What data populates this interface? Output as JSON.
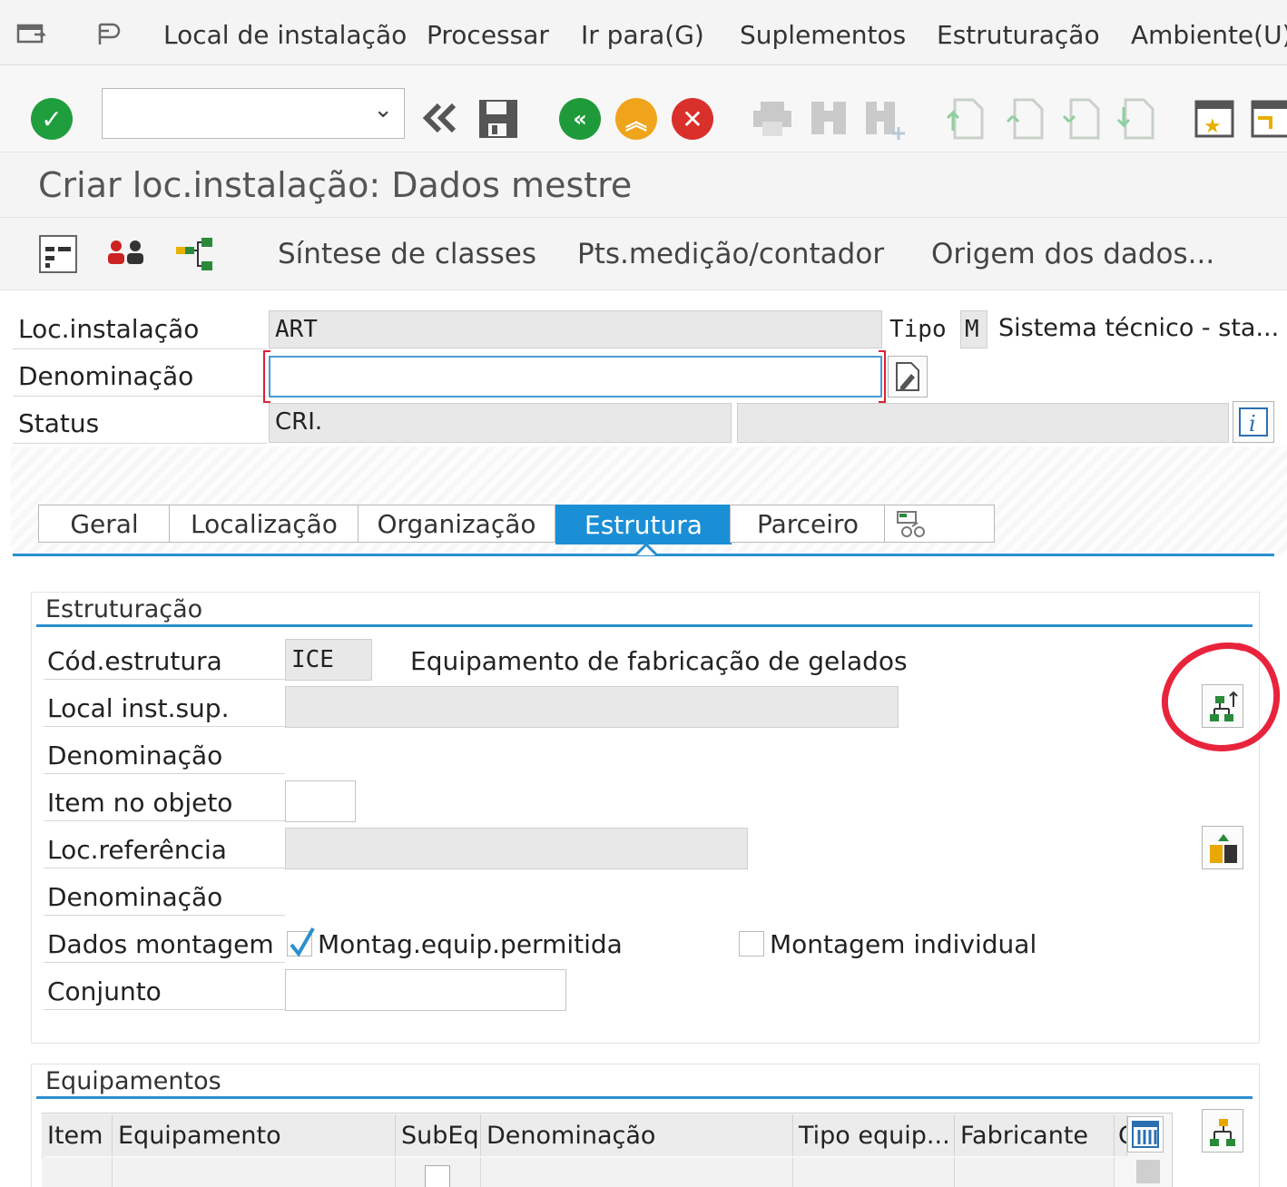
{
  "menu": {
    "items": [
      "Local de instalação",
      "Processar",
      "Ir para(G)",
      "Suplementos",
      "Estruturação",
      "Ambiente(U)"
    ]
  },
  "toolbar": {
    "command_field_value": "",
    "icons": [
      "enter-icon",
      "back-double-icon",
      "save-icon",
      "back-icon",
      "exit-icon",
      "cancel-icon",
      "print-icon",
      "find-icon",
      "find-next-icon",
      "first-page-icon",
      "previous-page-icon",
      "next-page-icon",
      "last-page-icon",
      "create-session-icon",
      "shortcut-icon"
    ]
  },
  "title": "Criar loc.instalação: Dados mestre",
  "app_toolbar": {
    "links": [
      "Síntese de classes",
      "Pts.medição/contador",
      "Origem dos dados..."
    ]
  },
  "header": {
    "loc_instalacao_label": "Loc.instalação",
    "loc_instalacao_value": "ART",
    "tipo_label": "Tipo",
    "tipo_value": "M",
    "tipo_text": "Sistema técnico - sta...",
    "denominacao_label": "Denominação",
    "denominacao_value": "",
    "status_label": "Status",
    "status_value": "CRI.",
    "status_value2": ""
  },
  "tabs": [
    {
      "label": "Geral",
      "active": false
    },
    {
      "label": "Localização",
      "active": false
    },
    {
      "label": "Organização",
      "active": false
    },
    {
      "label": "Estrutura",
      "active": true
    },
    {
      "label": "Parceiro",
      "active": false
    }
  ],
  "estruturacao": {
    "title": "Estruturação",
    "cod_estrutura_label": "Cód.estrutura",
    "cod_estrutura_value": "ICE",
    "cod_estrutura_text": "Equipamento de fabricação de gelados",
    "local_inst_sup_label": "Local inst.sup.",
    "local_inst_sup_value": "",
    "denominacao1_label": "Denominação",
    "item_no_objeto_label": "Item no objeto",
    "item_no_objeto_value": "",
    "loc_referencia_label": "Loc.referência",
    "loc_referencia_value": "",
    "denominacao2_label": "Denominação",
    "dados_montagem_label": "Dados montagem",
    "montag_equip_permitida_label": "Montag.equip.permitida",
    "montag_equip_permitida_checked": true,
    "montagem_individual_label": "Montagem individual",
    "montagem_individual_checked": false,
    "conjunto_label": "Conjunto",
    "conjunto_value": ""
  },
  "equipamentos": {
    "title": "Equipamentos",
    "columns": [
      "Item",
      "Equipamento",
      "SubEq",
      "Denominação",
      "Tipo equip...",
      "Fabricante",
      "C"
    ]
  },
  "annotation_color": "#e8243c",
  "accent_color": "#1b8fd6"
}
